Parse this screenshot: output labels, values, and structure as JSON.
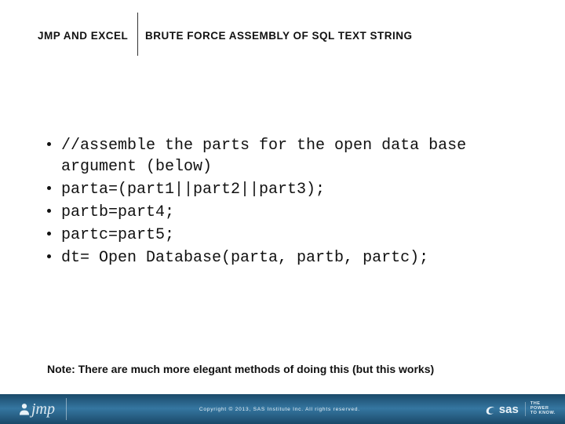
{
  "header": {
    "left": "JMP AND EXCEL",
    "right": "BRUTE FORCE ASSEMBLY OF SQL TEXT STRING"
  },
  "bullets": [
    "//assemble the parts for the open data base argument (below)",
    "parta=(part1||part2||part3);",
    "partb=part4;",
    "partc=part5;",
    "dt= Open Database(parta, partb, partc);"
  ],
  "note": "Note: There are much more elegant methods of doing this (but this works)",
  "footer": {
    "brand_jmp": "jmp",
    "copyright": "Copyright © 2013, SAS Institute Inc. All rights reserved.",
    "brand_sas": "sas",
    "tagline1": "THE",
    "tagline2": "POWER",
    "tagline3": "TO KNOW."
  }
}
